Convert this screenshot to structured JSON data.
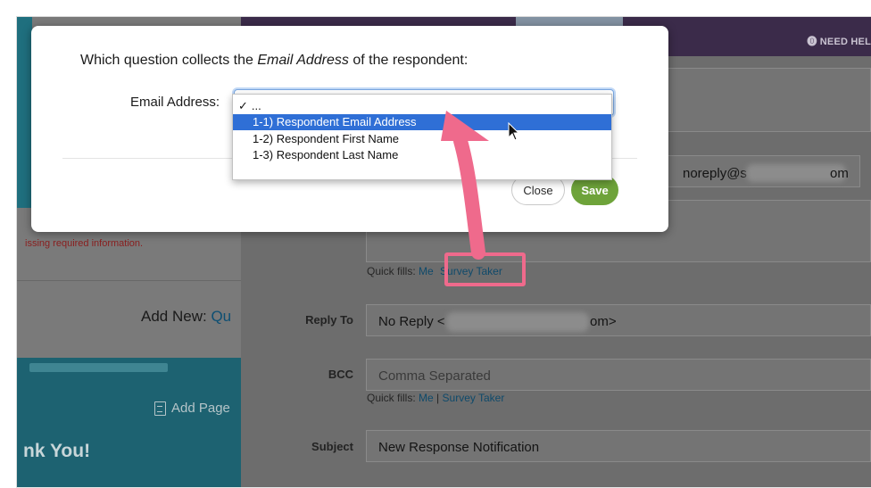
{
  "background": {
    "need_help": "⓿ NEED HEL",
    "left": {
      "error_text": "issing required information.",
      "add_new_label": "Add New:",
      "add_new_link": "Qu",
      "add_page_label": "Add Page",
      "thank_you": "nk You!"
    },
    "form": {
      "from_value_start": "noreply@s",
      "from_value_end": "om",
      "quick_fills_label": "Quick fills:",
      "quick_fill_me": "Me",
      "quick_fill_survey_taker": "Survey Taker",
      "reply_to_label": "Reply To",
      "reply_to_value_start": "No Reply <",
      "reply_to_value_end": "om>",
      "bcc_label": "BCC",
      "bcc_placeholder": "Comma Separated",
      "bcc_quick_fills_label": "Quick fills:",
      "bcc_quick_fill_me": "Me",
      "bcc_separator": "|",
      "bcc_quick_fill_survey_taker": "Survey Taker",
      "subject_label": "Subject",
      "subject_value": "New Response Notification"
    }
  },
  "modal": {
    "question_prefix": "Which question collects the ",
    "question_emphasis": "Email Address",
    "question_suffix": " of the respondent:",
    "field_label": "Email Address:",
    "close_button": "Close",
    "save_button": "Save"
  },
  "dropdown": {
    "checkmark": "✓",
    "options": [
      {
        "label": "...",
        "selected": false,
        "checked": true
      },
      {
        "label": "1-1) Respondent Email Address",
        "selected": true,
        "checked": false
      },
      {
        "label": "1-2) Respondent First Name",
        "selected": false,
        "checked": false
      },
      {
        "label": "1-3) Respondent Last Name",
        "selected": false,
        "checked": false
      }
    ]
  },
  "colors": {
    "save_green": "#6ea33a",
    "selection_blue": "#2f6fd6",
    "annotation_pink": "#ef6a8c",
    "header_purple": "#3b2b4a",
    "teal": "#1d6271"
  }
}
